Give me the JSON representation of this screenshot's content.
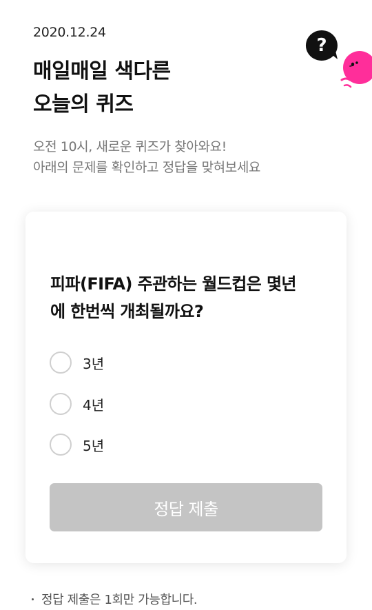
{
  "header": {
    "date": "2020.12.24",
    "title_line1": "매일매일 색다른",
    "title_line2": "오늘의 퀴즈",
    "desc_line1": "오전 10시, 새로운 퀴즈가 찾아와요!",
    "desc_line2": "아래의 문제를 확인하고 정답을 맞혀보세요"
  },
  "mascot": {
    "bubble_text": "?",
    "bubble_color": "#111111",
    "character_color": "#ff2e9a"
  },
  "quiz": {
    "question_line1": "피파(FIFA) 주관하는 월드컵은 몇년",
    "question_line2": "에 한번씩 개최될까요?",
    "options": [
      {
        "label": "3년"
      },
      {
        "label": "4년"
      },
      {
        "label": "5년"
      }
    ],
    "submit_label": "정답 제출",
    "submit_color": "#c4c4c4"
  },
  "footer": {
    "note": "정답 제출은 1회만 가능합니다."
  }
}
